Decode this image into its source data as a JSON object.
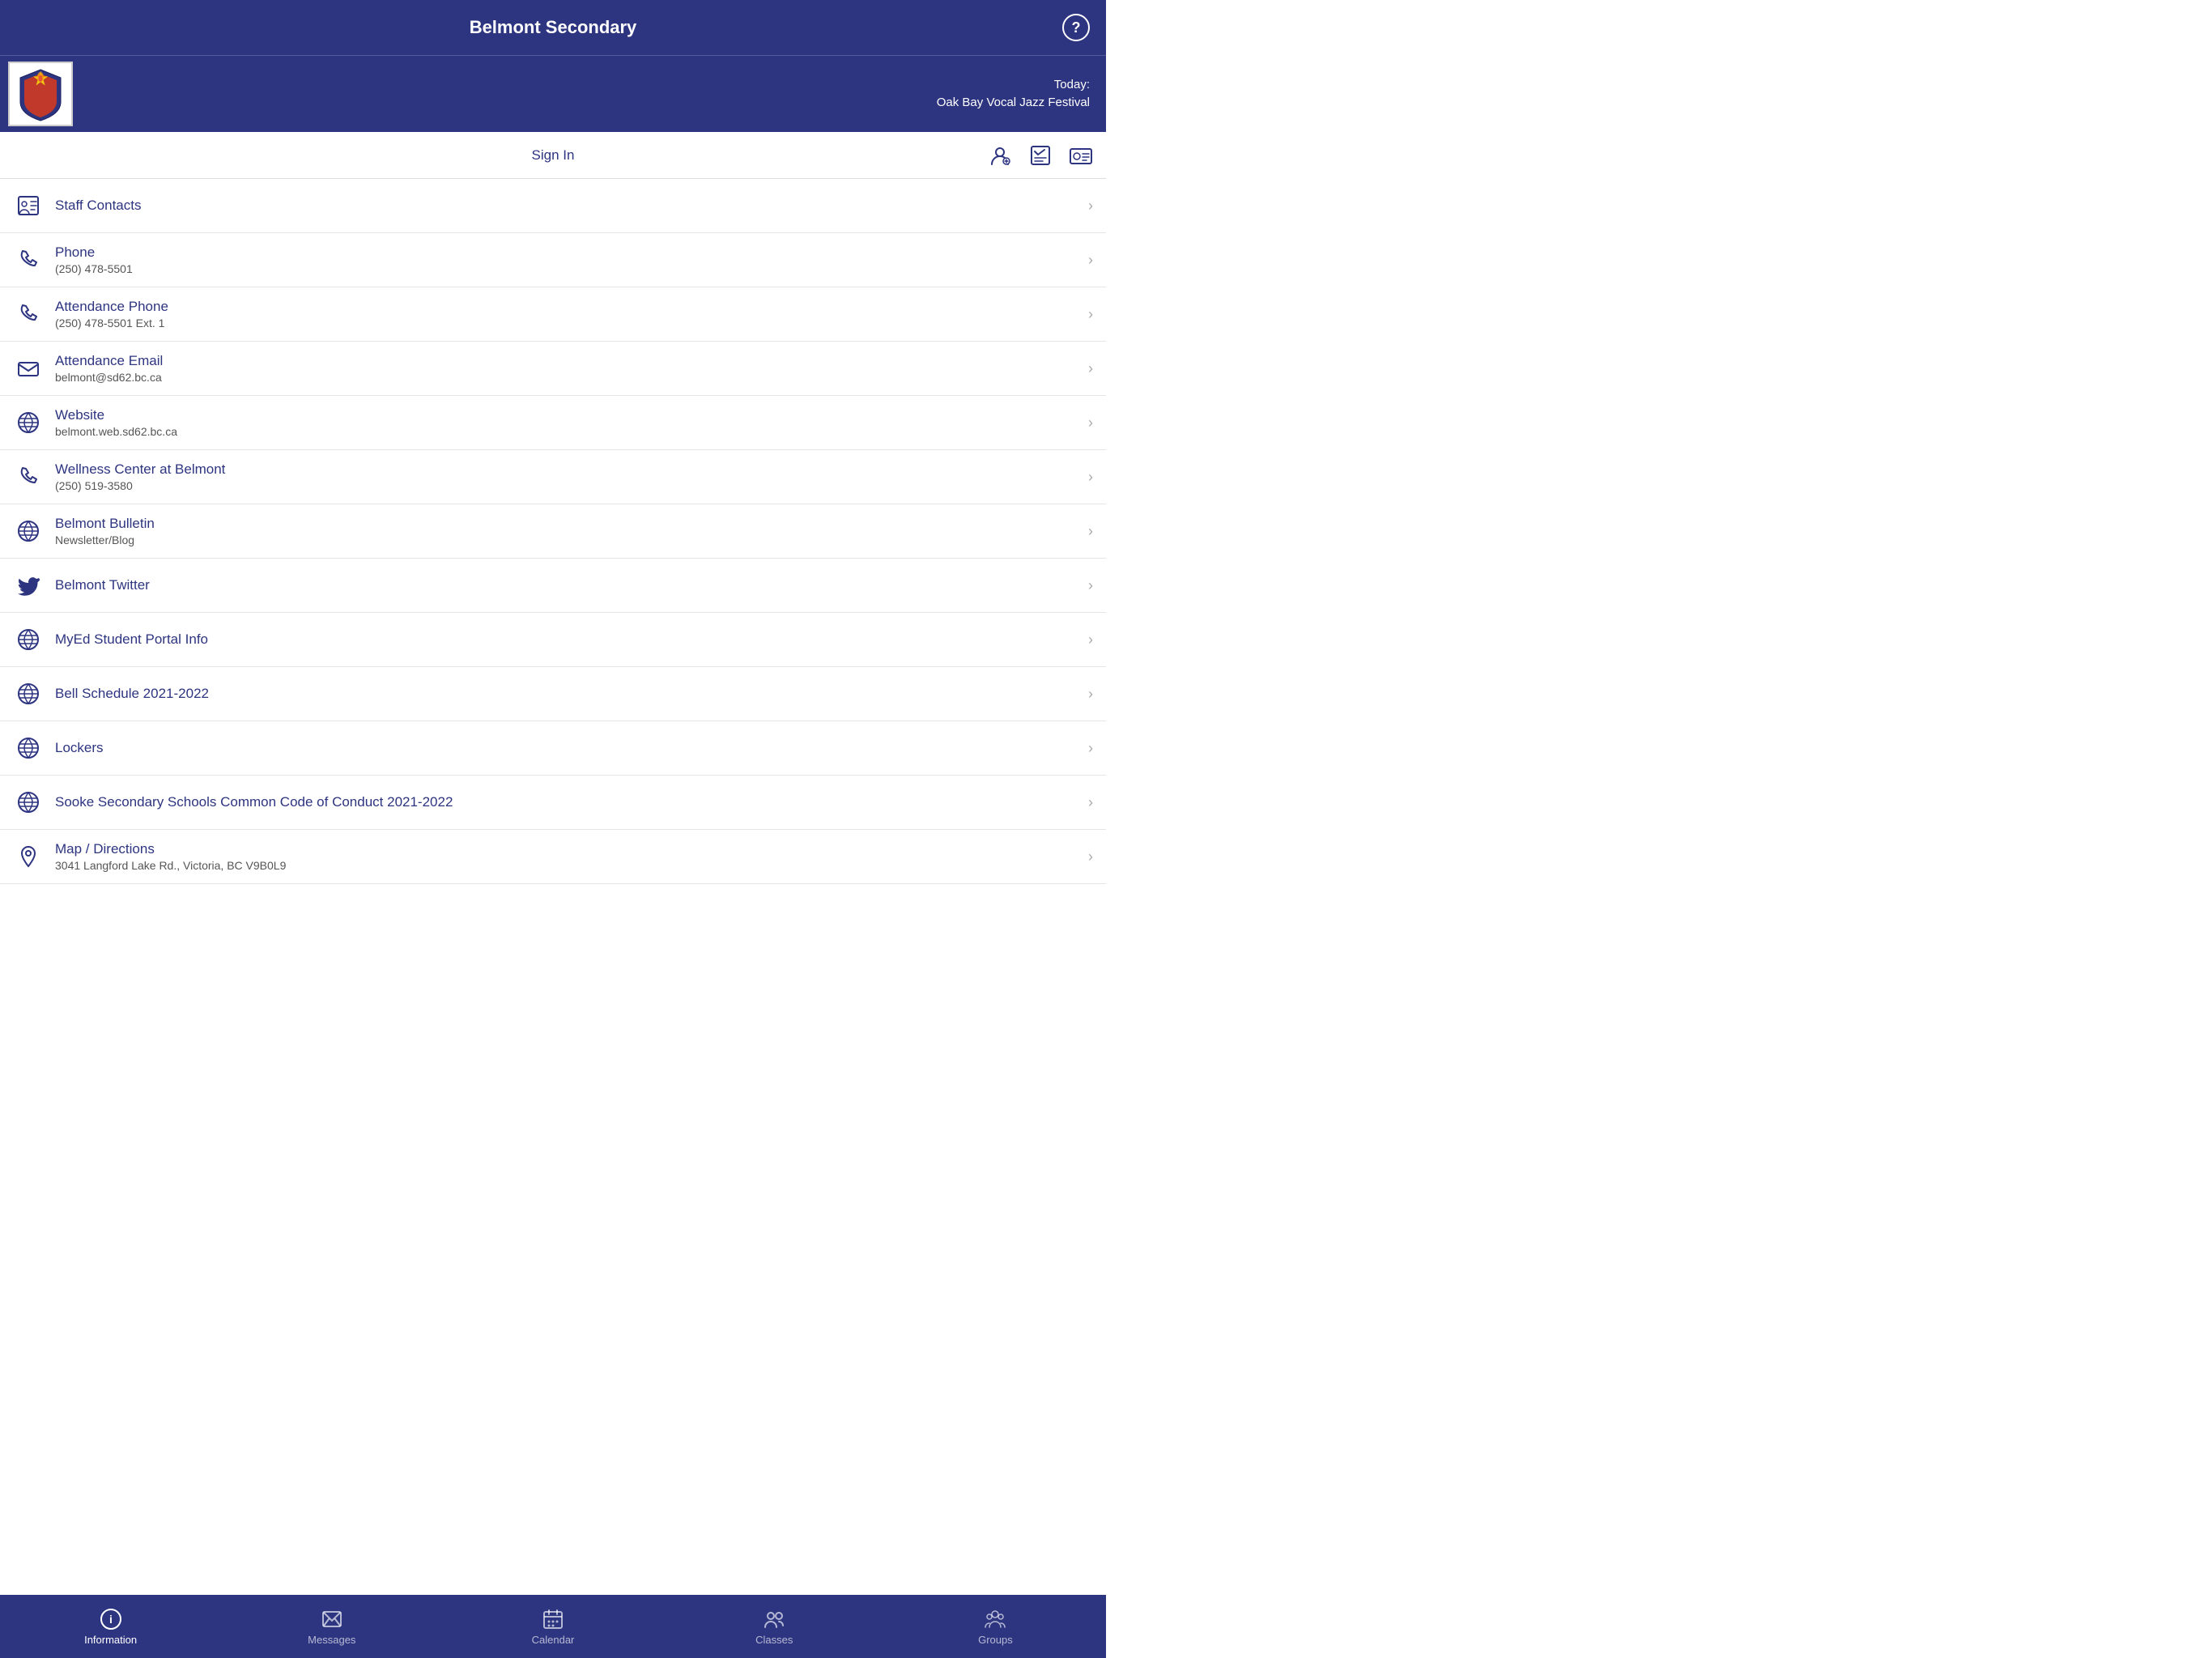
{
  "app": {
    "title": "Belmont Secondary",
    "help_label": "?"
  },
  "header": {
    "today_label": "Today:",
    "today_event": "Oak Bay Vocal Jazz Festival"
  },
  "signin": {
    "label": "Sign In"
  },
  "list_items": [
    {
      "id": "staff-contacts",
      "icon": "staff",
      "title": "Staff Contacts",
      "subtitle": ""
    },
    {
      "id": "phone",
      "icon": "phone",
      "title": "Phone",
      "subtitle": "(250) 478-5501"
    },
    {
      "id": "attendance-phone",
      "icon": "phone",
      "title": "Attendance Phone",
      "subtitle": "(250) 478-5501 Ext. 1"
    },
    {
      "id": "attendance-email",
      "icon": "email",
      "title": "Attendance Email",
      "subtitle": "belmont@sd62.bc.ca"
    },
    {
      "id": "website",
      "icon": "link",
      "title": "Website",
      "subtitle": "belmont.web.sd62.bc.ca"
    },
    {
      "id": "wellness-center",
      "icon": "phone",
      "title": "Wellness Center at Belmont",
      "subtitle": "(250) 519-3580"
    },
    {
      "id": "belmont-bulletin",
      "icon": "link",
      "title": "Belmont Bulletin",
      "subtitle": "Newsletter/Blog"
    },
    {
      "id": "belmont-twitter",
      "icon": "twitter",
      "title": "Belmont Twitter",
      "subtitle": ""
    },
    {
      "id": "myed-portal",
      "icon": "link",
      "title": "MyEd Student Portal Info",
      "subtitle": ""
    },
    {
      "id": "bell-schedule",
      "icon": "link",
      "title": "Bell Schedule 2021-2022",
      "subtitle": ""
    },
    {
      "id": "lockers",
      "icon": "link",
      "title": "Lockers",
      "subtitle": ""
    },
    {
      "id": "code-of-conduct",
      "icon": "link",
      "title": "Sooke Secondary Schools Common Code of Conduct 2021-2022",
      "subtitle": ""
    },
    {
      "id": "map-directions",
      "icon": "map",
      "title": "Map / Directions",
      "subtitle": "3041 Langford Lake Rd., Victoria, BC V9B0L9"
    }
  ],
  "tabs": [
    {
      "id": "information",
      "label": "Information",
      "icon": "info",
      "active": true
    },
    {
      "id": "messages",
      "label": "Messages",
      "icon": "messages",
      "active": false
    },
    {
      "id": "calendar",
      "label": "Calendar",
      "icon": "calendar",
      "active": false
    },
    {
      "id": "classes",
      "label": "Classes",
      "icon": "classes",
      "active": false
    },
    {
      "id": "groups",
      "label": "Groups",
      "icon": "groups",
      "active": false
    }
  ]
}
